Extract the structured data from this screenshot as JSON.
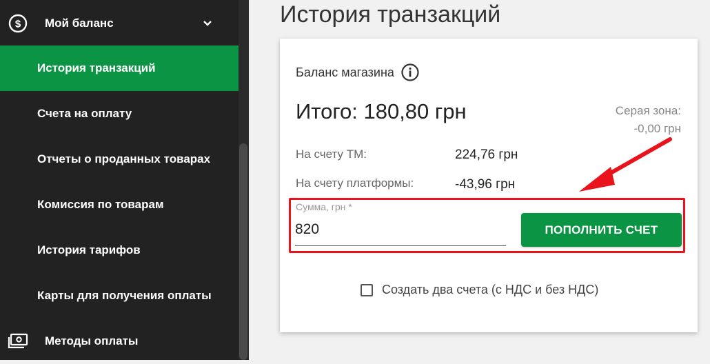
{
  "sidebar": {
    "balance_label": "Мой баланс",
    "items": [
      {
        "label": "История транзакций",
        "active": true
      },
      {
        "label": "Счета на оплату"
      },
      {
        "label": "Отчеты о проданных товарах"
      },
      {
        "label": "Комиссия по товарам"
      },
      {
        "label": "История тарифов"
      },
      {
        "label": "Карты для получения оплаты"
      }
    ],
    "payment_methods_label": "Методы оплаты",
    "active_color": "#0b9444"
  },
  "main": {
    "title": "История транзакций",
    "card": {
      "title": "Баланс магазина",
      "total": "Итого: 180,80 грн",
      "gray_zone_label": "Серая зона:",
      "gray_zone_value": "-0,00 грн",
      "rows": [
        {
          "label": "На счету ТМ:",
          "value": "224,76 грн"
        },
        {
          "label": "На счету платформы:",
          "value": "-43,96 грн"
        }
      ],
      "amount_label": "Сумма, грн *",
      "amount_value": "820",
      "topup_button": "ПОПОЛНИТЬ СЧЕТ",
      "checkbox_label": "Создать два счета (с НДС и без НДС)",
      "checkbox_checked": false
    }
  },
  "colors": {
    "accent_green": "#0b9444",
    "highlight_red": "#e8131b"
  }
}
